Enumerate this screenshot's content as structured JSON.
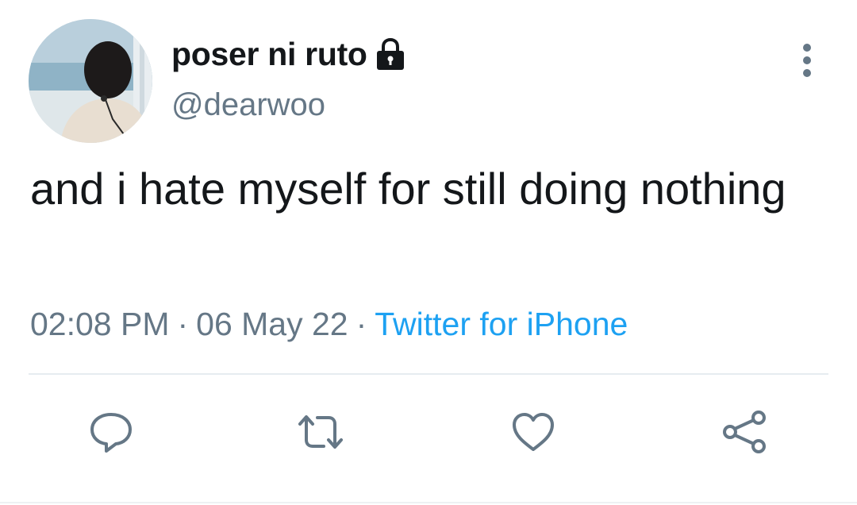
{
  "user": {
    "display_name": "poser ni ruto",
    "handle": "@dearwoo",
    "protected_icon": "lock-icon"
  },
  "tweet": {
    "text": "and i hate myself for still doing nothing",
    "time": "02:08 PM",
    "separator": "·",
    "date": "06 May 22",
    "source": "Twitter for iPhone"
  },
  "actions": {
    "reply_icon": "comment-icon",
    "retweet_icon": "retweet-icon",
    "like_icon": "heart-icon",
    "share_icon": "share-icon",
    "more_icon": "more-vertical-icon"
  },
  "colors": {
    "text": "#14171a",
    "secondary": "#657786",
    "link": "#1da1f2",
    "divider": "#e6ecf0"
  }
}
